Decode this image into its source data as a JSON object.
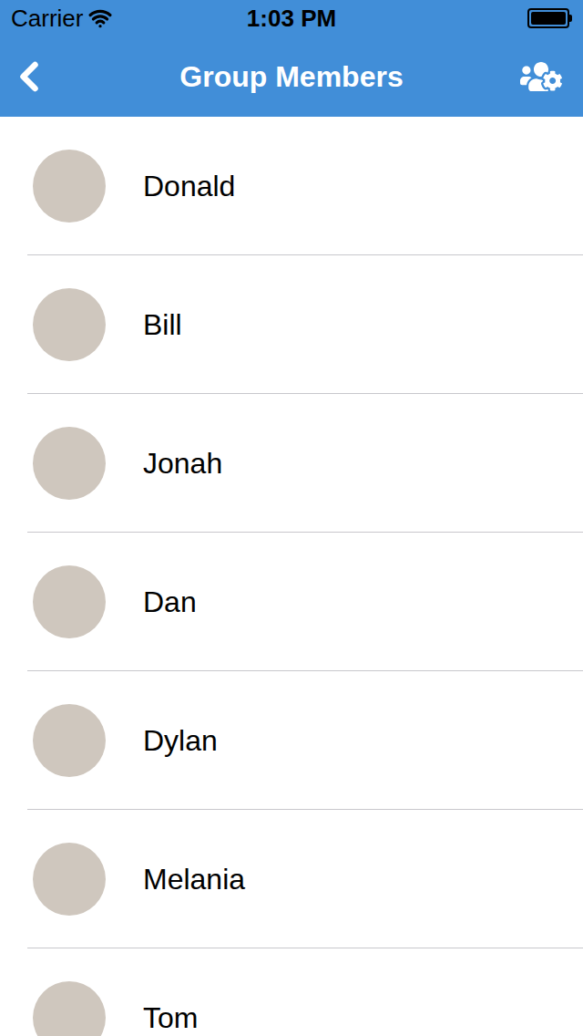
{
  "status_bar": {
    "carrier": "Carrier",
    "time": "1:03 PM",
    "battery": {
      "level": 1
    }
  },
  "nav_bar": {
    "title": "Group Members"
  },
  "members": [
    {
      "name": "Donald"
    },
    {
      "name": "Bill"
    },
    {
      "name": "Jonah"
    },
    {
      "name": "Dan"
    },
    {
      "name": "Dylan"
    },
    {
      "name": "Melania"
    },
    {
      "name": "Tom"
    }
  ]
}
